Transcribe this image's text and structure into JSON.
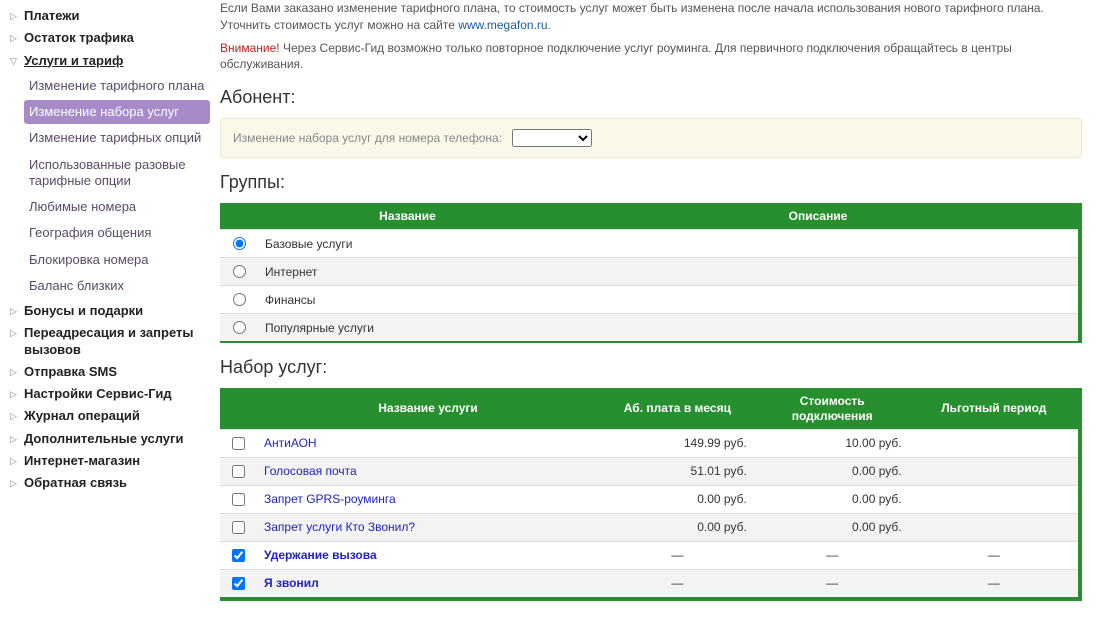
{
  "nav": {
    "items": [
      {
        "label": "Платежи",
        "arrow": "▷",
        "sub": null
      },
      {
        "label": "Остаток трафика",
        "arrow": "▷",
        "sub": null
      },
      {
        "label": "Услуги и тариф",
        "arrow": "▽",
        "underline": true,
        "sub": [
          {
            "label": "Изменение тарифного плана",
            "active": false
          },
          {
            "label": "Изменение набора услуг",
            "active": true
          },
          {
            "label": "Изменение тарифных опций",
            "active": false
          },
          {
            "label": "Использованные разовые тарифные опции",
            "active": false
          },
          {
            "label": "Любимые номера",
            "active": false
          },
          {
            "label": "География общения",
            "active": false
          },
          {
            "label": "Блокировка номера",
            "active": false
          },
          {
            "label": "Баланс близких",
            "active": false
          }
        ]
      },
      {
        "label": "Бонусы и подарки",
        "arrow": "▷",
        "sub": null
      },
      {
        "label": "Переадресация и запреты вызовов",
        "arrow": "▷",
        "sub": null
      },
      {
        "label": "Отправка SMS",
        "arrow": "▷",
        "sub": null
      },
      {
        "label": "Настройки Сервис-Гид",
        "arrow": "▷",
        "sub": null
      },
      {
        "label": "Журнал операций",
        "arrow": "▷",
        "sub": null
      },
      {
        "label": "Дополнительные услуги",
        "arrow": "▷",
        "sub": null
      },
      {
        "label": "Интернет-магазин",
        "arrow": "▷",
        "sub": null
      },
      {
        "label": "Обратная связь",
        "arrow": "▷",
        "sub": null
      }
    ]
  },
  "intro": {
    "line1": "Если Вами заказано изменение тарифного плана, то стоимость услуг может быть изменена после начала использования нового тарифного плана.",
    "line2a": "Уточнить стоимость услуг можно на сайте ",
    "link": "www.megafon.ru",
    "line2b": ".",
    "warn_label": "Внимание!",
    "warn_text": " Через Сервис-Гид возможно только повторное подключение услуг роуминга. Для первичного подключения обращайтесь в центры обслуживания."
  },
  "section_subscriber": "Абонент:",
  "filter_label": "Изменение набора услуг для номера телефона:",
  "section_groups": "Группы:",
  "groups": {
    "headers": {
      "name": "Название",
      "desc": "Описание"
    },
    "rows": [
      {
        "label": "Базовые услуги",
        "checked": true
      },
      {
        "label": "Интернет",
        "checked": false
      },
      {
        "label": "Финансы",
        "checked": false
      },
      {
        "label": "Популярные услуги",
        "checked": false
      }
    ]
  },
  "section_services": "Набор услуг:",
  "services": {
    "headers": {
      "name": "Название услуги",
      "fee": "Аб. плата в месяц",
      "connect": "Стоимость подключения",
      "grace": "Льготный период"
    },
    "rows": [
      {
        "name": "АнтиАОН",
        "fee": "149.99 руб.",
        "connect": "10.00 руб.",
        "grace": "",
        "checked": false,
        "bold": false
      },
      {
        "name": "Голосовая почта",
        "fee": "51.01 руб.",
        "connect": "0.00 руб.",
        "grace": "",
        "checked": false,
        "bold": false
      },
      {
        "name": "Запрет GPRS-роуминга",
        "fee": "0.00 руб.",
        "connect": "0.00 руб.",
        "grace": "",
        "checked": false,
        "bold": false
      },
      {
        "name": "Запрет услуги Кто Звонил?",
        "fee": "0.00 руб.",
        "connect": "0.00 руб.",
        "grace": "",
        "checked": false,
        "bold": false
      },
      {
        "name": "Удержание вызова",
        "fee": "—",
        "connect": "—",
        "grace": "—",
        "checked": true,
        "bold": true
      },
      {
        "name": "Я звонил",
        "fee": "—",
        "connect": "—",
        "grace": "—",
        "checked": true,
        "bold": true
      }
    ]
  }
}
